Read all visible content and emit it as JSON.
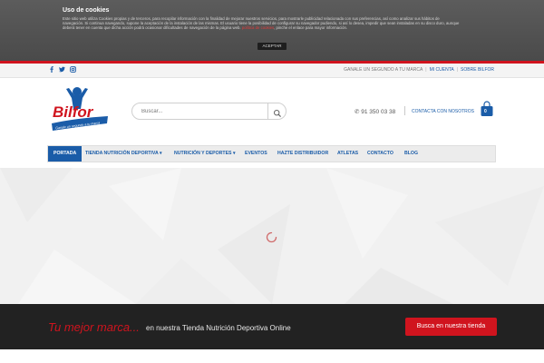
{
  "cookie": {
    "title": "Uso de cookies",
    "text": "Este sitio web utiliza Cookies propias y de terceros, para recopilar información con la finalidad de mejorar nuestros servicios, para mostrarle publicidad relacionada con sus preferencias, así como analizar sus hábitos de navegación. Si continua navegando, supone la aceptación de la instalación de las mismas. El usuario tiene la posibilidad de configurar su navegador pudiendo, si así lo desea, impedir que sean instaladas en su disco duro, aunque deberá tener en cuenta que dicha acción podrá ocasionar dificultades de navegación de la página web.",
    "link": "política de cookies",
    "text_after": ", pinche el enlace para mayor información.",
    "accept": "ACEPTAR"
  },
  "topbar": {
    "social": [
      "facebook-icon",
      "twitter-icon",
      "instagram-icon"
    ],
    "links": [
      "GANALE UN SEGUNDO A TU MARCA",
      "MI CUENTA",
      "SOBRE BILFOR"
    ]
  },
  "header": {
    "logo_text": "Bilfor",
    "logo_slogan": "Ganale un segundo a tu marca",
    "search_placeholder": "Buscar...",
    "phone": "91 350 03 38",
    "contact": "CONTACTA CON NOSOTROS",
    "cart_count": "0"
  },
  "nav": {
    "items": [
      "PORTADA",
      "TIENDA NUTRICIÓN DEPORTIVA",
      "NUTRICIÓN Y DEPORTES",
      "EVENTOS",
      "HAZTE DISTRIBUIDOR",
      "ATLETAS",
      "CONTACTO",
      "BLOG"
    ]
  },
  "promo": {
    "accent": "Tu mejor marca...",
    "text": "en nuestra Tienda Nutrición Deportiva Online",
    "button": "Busca en nuestra tienda"
  },
  "colors": {
    "brand_blue": "#1a5ca8",
    "brand_red": "#d0141e",
    "dark": "#222222"
  }
}
